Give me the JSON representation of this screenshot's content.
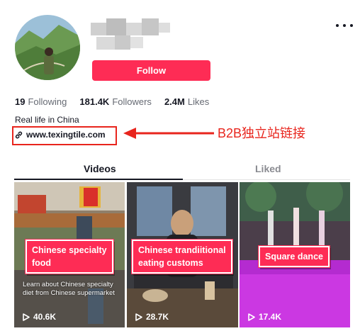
{
  "profile": {
    "follow_label": "Follow",
    "bio": "Real life in China",
    "link_text": "www.texingtile.com"
  },
  "stats": [
    {
      "value": "19",
      "label": "Following"
    },
    {
      "value": "181.4K",
      "label": "Followers"
    },
    {
      "value": "2.4M",
      "label": "Likes"
    }
  ],
  "annotation": {
    "text": "B2B独立站链接",
    "color": "#e8251d"
  },
  "tabs": [
    {
      "label": "Videos",
      "active": true
    },
    {
      "label": "Liked",
      "active": false
    }
  ],
  "videos": [
    {
      "caption": "Chinese specialty food",
      "subtext": "Learn about Chinese specialty diet from Chinese supermarket",
      "views": "40.6K"
    },
    {
      "caption": "Chinese trandiitional eating customs",
      "views": "28.7K"
    },
    {
      "caption": "Square dance",
      "views": "17.4K"
    }
  ],
  "colors": {
    "brand": "#fe2c55",
    "text": "#161823",
    "muted": "#666a73"
  },
  "icons": [
    "more-icon",
    "link-icon",
    "play-icon"
  ]
}
